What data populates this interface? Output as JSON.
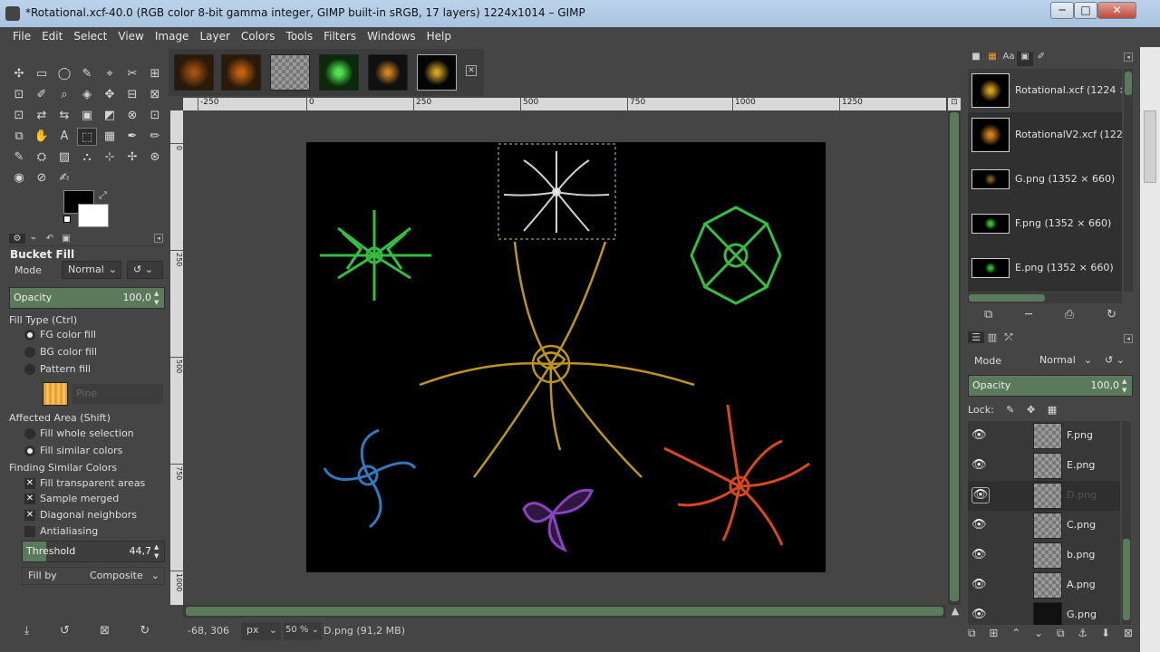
{
  "window": {
    "title": "*Rotational.xcf-40.0 (RGB color 8-bit gamma integer, GIMP built-in sRGB, 17 layers) 1224x1014 – GIMP",
    "minimize": "─",
    "maximize": "□",
    "close": "✕"
  },
  "menubar": {
    "items": [
      "File",
      "Edit",
      "Select",
      "View",
      "Image",
      "Layer",
      "Colors",
      "Tools",
      "Filters",
      "Windows",
      "Help"
    ]
  },
  "toolbox": {
    "tools": [
      "✣",
      "▭",
      "◯",
      "✎",
      "⌖",
      "✂",
      "⊞",
      "⊡",
      "✐",
      "⌕",
      "◈",
      "✥",
      "⊟",
      "⊠",
      "⊡",
      "⇄",
      "⇆",
      "▣",
      "◩",
      "⊗",
      "⊡",
      "⧉",
      "✋",
      "A",
      "⬚",
      "▦",
      "✒",
      "✏",
      "✎",
      "⛭",
      "▨",
      "⛬",
      "⊹",
      "✢",
      "⊛",
      "◉",
      "⊘",
      "✍"
    ],
    "active_tool_index": 24,
    "fg_color": "#000000",
    "bg_color": "#ffffff"
  },
  "tool_options": {
    "title": "Bucket Fill",
    "mode_label": "Mode",
    "mode_value": "Normal",
    "opacity_label": "Opacity",
    "opacity_value": "100,0",
    "opacity": 100.0,
    "fill_type_label": "Fill Type  (Ctrl)",
    "fill_options": [
      "FG color fill",
      "BG color fill",
      "Pattern fill"
    ],
    "fill_selected": 0,
    "pattern_name": "Pine",
    "affected_area_label": "Affected Area  (Shift)",
    "area_options": [
      "Fill whole selection",
      "Fill similar colors"
    ],
    "area_selected": 1,
    "finding_label": "Finding Similar Colors",
    "checkboxes": [
      {
        "label": "Fill transparent areas",
        "checked": true
      },
      {
        "label": "Sample merged",
        "checked": true
      },
      {
        "label": "Diagonal neighbors",
        "checked": true
      },
      {
        "label": "Antialiasing",
        "checked": false
      }
    ],
    "threshold_label": "Threshold",
    "threshold_value": "44,7",
    "threshold": 44.7,
    "fill_by_label": "Fill by",
    "fill_by_value": "Composite"
  },
  "rulers": {
    "horizontal": [
      "-250",
      "0",
      "250",
      "500",
      "750",
      "1000",
      "1250"
    ],
    "vertical": [
      "0",
      "250",
      "500",
      "750",
      "1000"
    ]
  },
  "statusbar": {
    "coords": "-68, 306",
    "unit": "px",
    "zoom": "50 %",
    "message": "D.png (91,2 MB)"
  },
  "images_panel": {
    "items": [
      {
        "name": "Rotational.xcf (1224 ×"
      },
      {
        "name": "RotationalV2.xcf (1224"
      },
      {
        "name": "G.png (1352 × 660)"
      },
      {
        "name": "F.png (1352 × 660)"
      },
      {
        "name": "E.png (1352 × 660)"
      }
    ]
  },
  "layers_panel": {
    "mode_label": "Mode",
    "mode_value": "Normal",
    "opacity_label": "Opacity",
    "opacity_value": "100,0",
    "opacity": 100.0,
    "lock_label": "Lock:",
    "layers": [
      {
        "name": "F.png"
      },
      {
        "name": "E.png"
      },
      {
        "name": "D.png"
      },
      {
        "name": "C.png"
      },
      {
        "name": "b.png"
      },
      {
        "name": "A.png"
      },
      {
        "name": "G.png"
      }
    ],
    "selected_index": 2
  },
  "colors": {
    "accent_green": "#5b7a5b",
    "ornament_green": "#3ee04a",
    "ornament_gold": "#e0b020",
    "ornament_orange": "#ff5520",
    "ornament_blue": "#3a8ee0",
    "ornament_purple": "#a050e0",
    "ornament_white": "#e8e8e8"
  }
}
